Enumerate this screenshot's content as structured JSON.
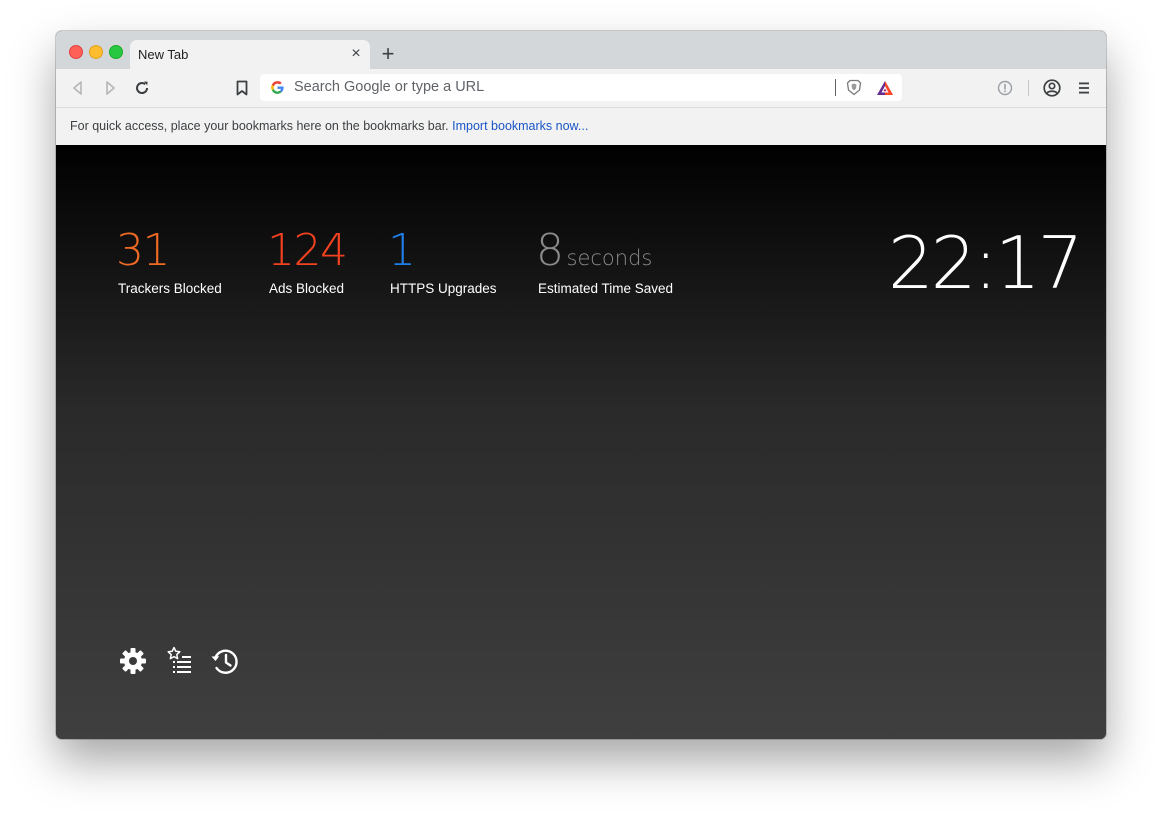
{
  "browser": {
    "tab": {
      "title": "New Tab",
      "close_symbol": "×"
    },
    "new_tab_symbol": "+",
    "omnibox": {
      "placeholder": "Search Google or type a URL"
    },
    "bookmarks_bar": {
      "message": "For quick access, place your bookmarks here on the bookmarks bar.",
      "link": "Import bookmarks now..."
    }
  },
  "stats": [
    {
      "value": "31",
      "label": "Trackers Blocked",
      "color": "#ef6a24"
    },
    {
      "value": "124",
      "label": "Ads Blocked",
      "color": "#f2421f"
    },
    {
      "value": "1",
      "label": "HTTPS Upgrades",
      "color": "#1f7fe8"
    },
    {
      "value": "8",
      "unit": "seconds",
      "label": "Estimated Time Saved",
      "color": "#8b8b8b"
    }
  ],
  "clock": {
    "time": "22:17"
  },
  "icons": {
    "back": "back-arrow-icon",
    "forward": "forward-arrow-icon",
    "reload": "reload-icon",
    "bookmark": "bookmark-icon",
    "google": "google-icon",
    "brave_shields": "brave-shields-icon",
    "bat_rewards": "bat-rewards-icon",
    "extension": "extension-icon",
    "profile": "profile-icon",
    "menu": "menu-icon",
    "settings": "gear-icon",
    "bookmarks_list": "bookmarks-list-icon",
    "history": "history-icon"
  }
}
